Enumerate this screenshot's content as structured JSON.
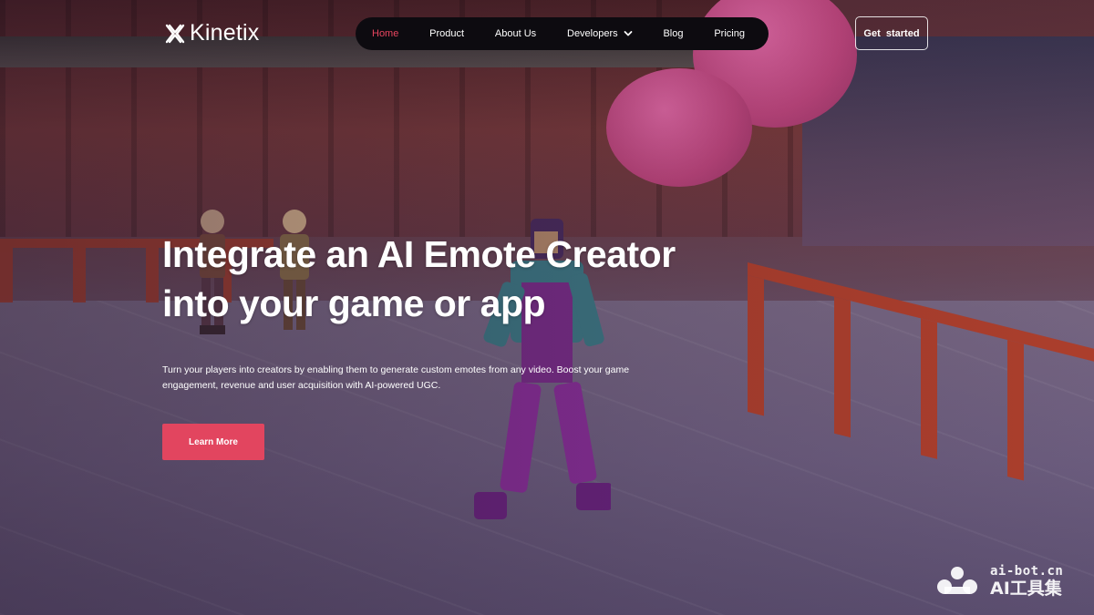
{
  "brand": {
    "name": "Kinetix",
    "accent_color": "#e2455f"
  },
  "nav": {
    "items": [
      {
        "label": "Home",
        "active": true
      },
      {
        "label": "Product",
        "active": false
      },
      {
        "label": "About Us",
        "active": false
      },
      {
        "label": "Developers",
        "active": false,
        "has_dropdown": true
      },
      {
        "label": "Blog",
        "active": false
      },
      {
        "label": "Pricing",
        "active": false
      }
    ],
    "cta_label": "Get  started"
  },
  "hero": {
    "headline_line1": "Integrate an AI Emote Creator",
    "headline_line2": "into your game or app",
    "subtext": "Turn your players into creators by enabling them to generate custom emotes from any video. Boost your game engagement, revenue and user acquisition with AI-powered UGC.",
    "button_label": "Learn More"
  },
  "watermark": {
    "top": "ai-bot.cn",
    "bottom": "AI工具集"
  }
}
